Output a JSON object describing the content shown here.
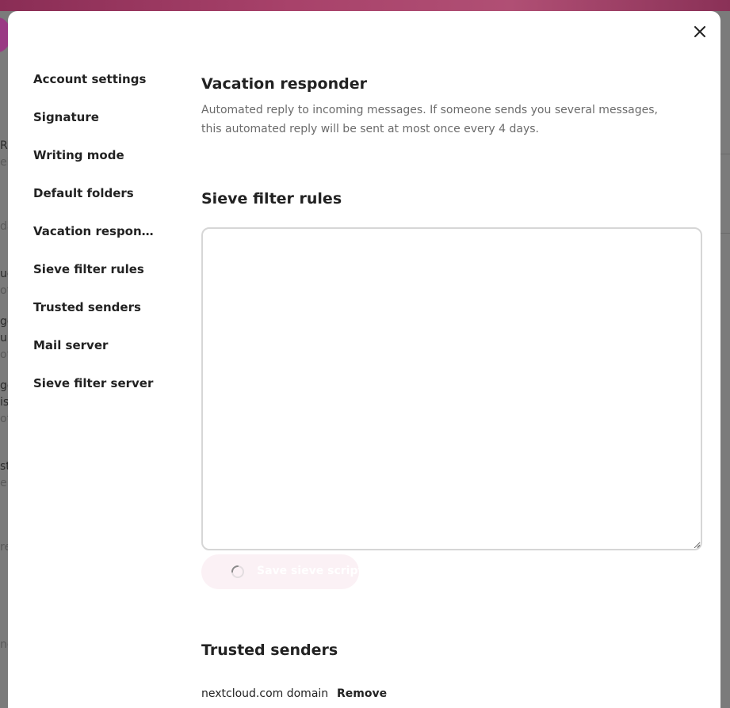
{
  "modal": {
    "close_label": "Close"
  },
  "nav": {
    "items": [
      {
        "label": "Account settings"
      },
      {
        "label": "Signature"
      },
      {
        "label": "Writing mode"
      },
      {
        "label": "Default folders"
      },
      {
        "label": "Vacation respon…"
      },
      {
        "label": "Sieve filter rules"
      },
      {
        "label": "Trusted senders"
      },
      {
        "label": "Mail server"
      },
      {
        "label": "Sieve filter server"
      }
    ]
  },
  "vacation": {
    "title": "Vacation responder",
    "description": "Automated reply to incoming messages. If someone sends you several messages, this automated reply will be sent at most once every 4 days."
  },
  "sieve": {
    "title": "Sieve filter rules",
    "script_value": "",
    "save_label": "Save sieve script"
  },
  "trusted": {
    "title": "Trusted senders",
    "entries": [
      {
        "domain": "nextcloud.com domain",
        "action": "Remove"
      }
    ]
  },
  "background": {
    "fragments": [
      "Re",
      "ele",
      "da",
      "uc",
      "ot",
      "ge",
      "u l",
      "ot",
      "ge",
      "is",
      "ot",
      "st",
      "e",
      "re",
      "nc"
    ]
  },
  "colors": {
    "accent": "#b04f74",
    "save_button_bg": "#fbf1f5",
    "muted_text": "#6b6b6b"
  }
}
